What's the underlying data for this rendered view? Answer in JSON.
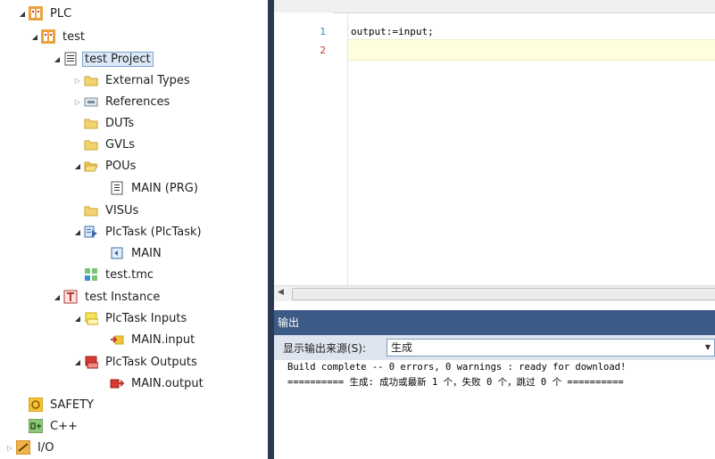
{
  "tree": {
    "plc": "PLC",
    "test": "test",
    "test_project": "test Project",
    "external_types": "External Types",
    "references": "References",
    "duts": "DUTs",
    "gvls": "GVLs",
    "pous": "POUs",
    "main_prg": "MAIN (PRG)",
    "visus": "VISUs",
    "plctask": "PlcTask (PlcTask)",
    "plctask_main": "MAIN",
    "test_tmc": "test.tmc",
    "test_instance": "test Instance",
    "plctask_inputs": "PlcTask Inputs",
    "main_input": "MAIN.input",
    "plctask_outputs": "PlcTask Outputs",
    "main_output": "MAIN.output",
    "safety": "SAFETY",
    "cpp": "C++",
    "io": "I/O"
  },
  "editor": {
    "line1_no": "1",
    "line1_code": "output:=input;",
    "line2_no": "2"
  },
  "output": {
    "title": "输出",
    "source_label": "显示输出来源(S):",
    "source_value": "生成",
    "line1": "Build complete -- 0 errors, 0 warnings : ready for download!",
    "line2": "========== 生成: 成功或最新 1 个，失败 0 个，跳过 0 个 =========="
  },
  "colors": {
    "splitter": "#293955",
    "output_title_bg": "#3c5a86",
    "selection": "#dbe8f7",
    "current_line": "#ffffe0",
    "line_number": "#2b91af"
  }
}
